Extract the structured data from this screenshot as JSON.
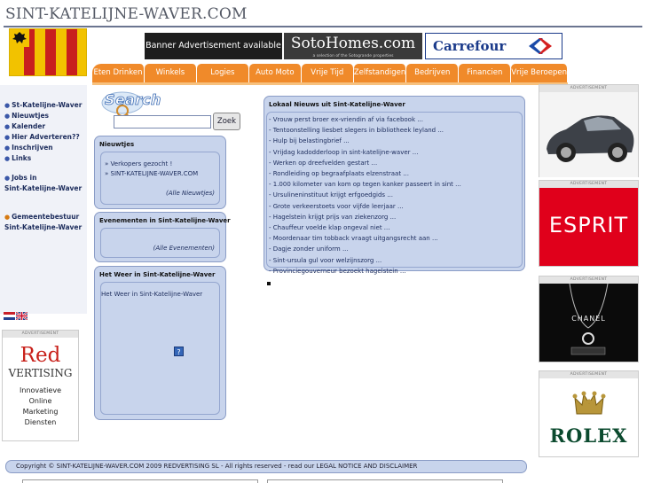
{
  "site": {
    "title": "SINT-KATELIJNE-WAVER.COM"
  },
  "banners": {
    "text_ad": "Banner Advertisement available",
    "soto_name": "SotoHomes.com",
    "soto_tagline": "a selection of the Sotogrande properties",
    "carrefour": "Carrefour"
  },
  "nav": [
    {
      "label": "Eten Drinken"
    },
    {
      "label": "Winkels"
    },
    {
      "label": "Logies"
    },
    {
      "label": "Auto Moto"
    },
    {
      "label": "Vrije Tijd"
    },
    {
      "label": "Zelfstandigen"
    },
    {
      "label": "Bedrijven"
    },
    {
      "label": "Financien"
    },
    {
      "label": "Vrije Beroepen"
    }
  ],
  "sidebar": {
    "links": [
      {
        "label": "St-Katelijne-Waver"
      },
      {
        "label": "Nieuwtjes"
      },
      {
        "label": "Kalender"
      },
      {
        "label": "Hier Adverteren??"
      },
      {
        "label": "Inschrijven"
      },
      {
        "label": "Links"
      },
      {
        "label": "Jobs in"
      },
      {
        "label": "Sint-Katelijne-Waver"
      },
      {
        "label": "Gemeentebestuur"
      },
      {
        "label": "Sint-Katelijne-Waver"
      }
    ]
  },
  "ads": {
    "label": "ADVERTISEMENT",
    "red_title": "Red",
    "red_sub": "VERTISING",
    "red_body": "Innovatieve\nOnline\nMarketing\nDiensten",
    "esprit": "ESPRIT",
    "chanel": "CHANEL",
    "rolex": "ROLEX"
  },
  "search": {
    "logo_text": "Search",
    "placeholder": "",
    "button": "Zoek"
  },
  "news_box": {
    "title": "Nieuwtjes",
    "items": [
      "Verkopers gezocht !",
      "SINT-KATELIJNE-WAVER.COM"
    ],
    "all_link": "(Alle Nieuwtjes)"
  },
  "events_box": {
    "title": "Evenementen in Sint-Katelijne-Waver",
    "all_link": "(Alle Evenementen)"
  },
  "weather_box": {
    "title": "Het Weer in Sint-Katelijne-Waver",
    "content": "Het Weer in Sint-Katelijne-Waver",
    "icon": "?"
  },
  "local_news": {
    "title": "Lokaal Nieuws uit Sint-Katelijne-Waver",
    "items": [
      "- Vrouw perst broer ex-vriendin af via facebook ...",
      "- Tentoonstelling liesbet slegers in bibliotheek leyland ...",
      "- Hulp bij belastingbrief ...",
      "- Vrijdag kadodderloop in sint-katelijne-waver ...",
      "- Werken op dreefvelden gestart ...",
      "- Rondleiding op begraafplaats elzenstraat ...",
      "- 1.000 kilometer van kom op tegen kanker passeert in sint ...",
      "- Ursulineninstituut krijgt erfgoedgids ...",
      "- Grote verkeerstoets voor vijfde leerjaar ...",
      "- Hagelstein krijgt prijs van ziekenzorg ...",
      "- Chauffeur voelde klap ongeval niet ...",
      "- Moordenaar tim tobback vraagt uitgangsrecht aan ...",
      "- Dagje zonder uniform ...",
      "- Sint-ursula gul voor welzijnszorg ...",
      "- Provinciegouverneur bezoekt hagelstein ..."
    ]
  },
  "footer": {
    "text": "Copyright © SINT-KATELIJNE-WAVER.COM 2009 REDVERTISING SL - All rights reserved - read our LEGAL NOTICE AND DISCLAIMER"
  },
  "colors": {
    "nav": "#f08a2a",
    "box": "#c8d4ec",
    "link": "#1c2c5c",
    "title": "#555a66"
  }
}
